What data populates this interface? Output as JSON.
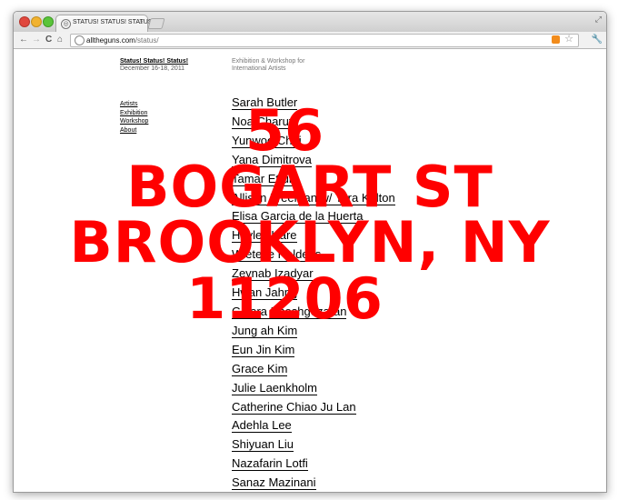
{
  "browser": {
    "tab_title": "STATUS! STATUS! STATUS!",
    "tab_close": "×",
    "url_host": "alltheguns.com",
    "url_path": "/status/",
    "back": "←",
    "forward": "→",
    "reload": "C",
    "home": "⌂",
    "favicon": "◎",
    "star": "☆",
    "wrench": "🔧",
    "resize": "⤢"
  },
  "site": {
    "title": "Status! Status! Status!",
    "dates": "December 16-18, 2011",
    "description": "Exhibition & Workshop for International Artists"
  },
  "nav": [
    "Artists",
    "Exhibition",
    "Workshop",
    "About"
  ],
  "artists": [
    "Sarah Butler",
    "Noa Charuvi",
    "Yunwoo Choi",
    "Yana Dimitrova",
    "Tamar Ettun",
    "Allison Freeman w/ Tara Kelton",
    "Elisa Garcia de la Huerta",
    "Hayley Hare",
    "Wieteke Heldens",
    "Zeynab Izadyar",
    "Hwan Jahng",
    "Golara Khoshgozaran",
    "Jung ah Kim",
    "Eun Jin Kim",
    "Grace Kim",
    "Julie Laenkholm",
    "Catherine Chiao Ju Lan",
    "Adehla Lee",
    "Shiyuan Liu",
    "Nazafarin Lotfi",
    "Sanaz Mazinani"
  ],
  "address": {
    "line1": "56",
    "line2": "BOGART ST",
    "line3": "BROOKLYN, NY",
    "line4": "11206"
  },
  "colors": {
    "address_red": "#ff0000"
  }
}
